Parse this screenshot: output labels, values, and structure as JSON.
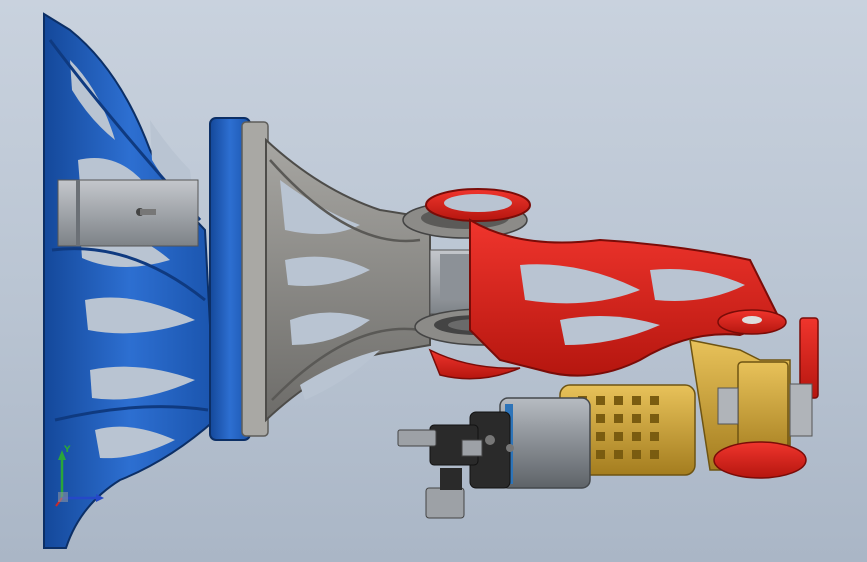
{
  "viewport": {
    "background_top": "#c9d2de",
    "background_bottom": "#aab6c6"
  },
  "assembly": {
    "parts": [
      {
        "name": "mounting-bracket",
        "color": "#1f5fb8"
      },
      {
        "name": "flange-plate",
        "color": "#2563c9"
      },
      {
        "name": "upper-link",
        "color": "#8a8884"
      },
      {
        "name": "forearm-link",
        "color": "#d8221e"
      },
      {
        "name": "wrist-housing",
        "color": "#c9a23a"
      },
      {
        "name": "gripper-body",
        "color": "#8e9399"
      },
      {
        "name": "gripper-jaws",
        "color": "#2a2a2a"
      }
    ]
  },
  "triad": {
    "x_color": "#2548c8",
    "y_color": "#2aa53a",
    "z_color": "#c82a2a",
    "y_label": "Y"
  }
}
